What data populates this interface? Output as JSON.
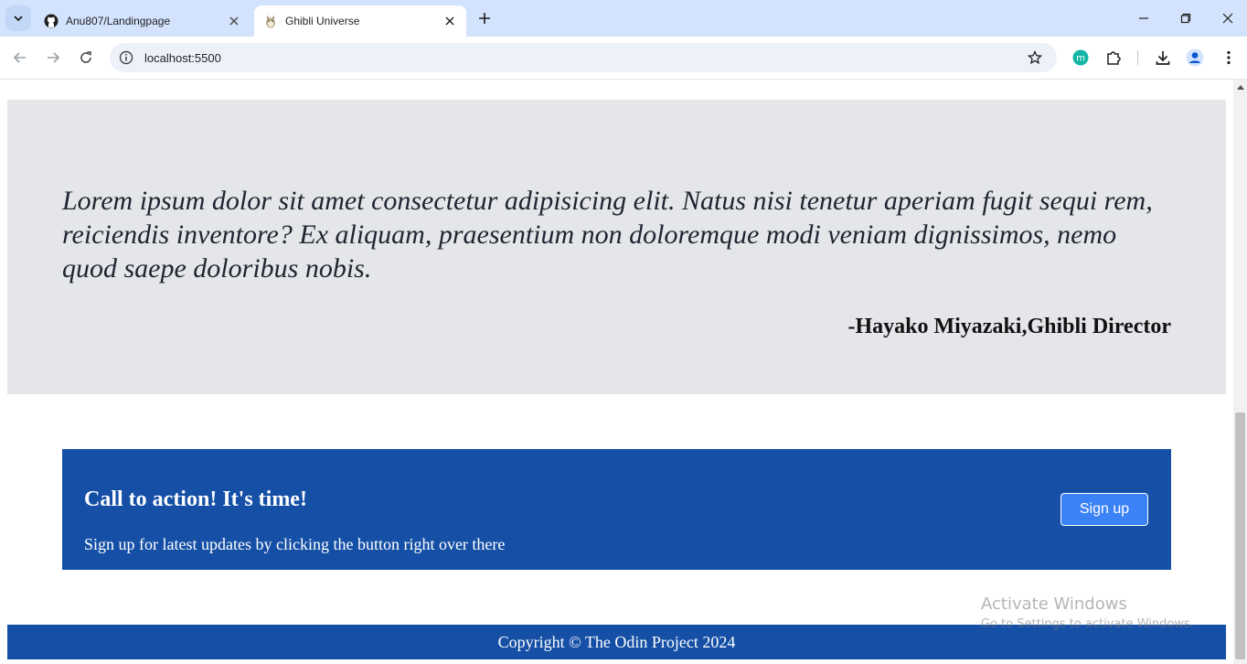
{
  "browser": {
    "tabs": [
      {
        "title": "Anu807/Landingpage",
        "icon": "github-icon",
        "active": false
      },
      {
        "title": "Ghibli Universe",
        "icon": "totoro-favicon-icon",
        "active": true
      }
    ],
    "url": "localhost:5500"
  },
  "quote": {
    "text": "Lorem ipsum dolor sit amet consectetur adipisicing elit. Natus nisi tenetur aperiam fugit sequi rem, reiciendis inventore? Ex aliquam, praesentium non doloremque modi veniam dignissimos, nemo quod saepe doloribus nobis.",
    "author": "-Hayako Miyazaki,Ghibli Director"
  },
  "cta": {
    "title": "Call to action! It's time!",
    "subtitle": "Sign up for latest updates by clicking the button right over there",
    "button_label": "Sign up"
  },
  "footer": {
    "text": "Copyright © The Odin Project 2024"
  },
  "watermark": {
    "line1": "Activate Windows",
    "line2": "Go to Settings to activate Windows."
  },
  "colors": {
    "tabbar": "#d3e3fd",
    "quote_bg": "#e5e6e9",
    "cta_bg": "#1550a6",
    "button_bg": "#3b82f6"
  }
}
